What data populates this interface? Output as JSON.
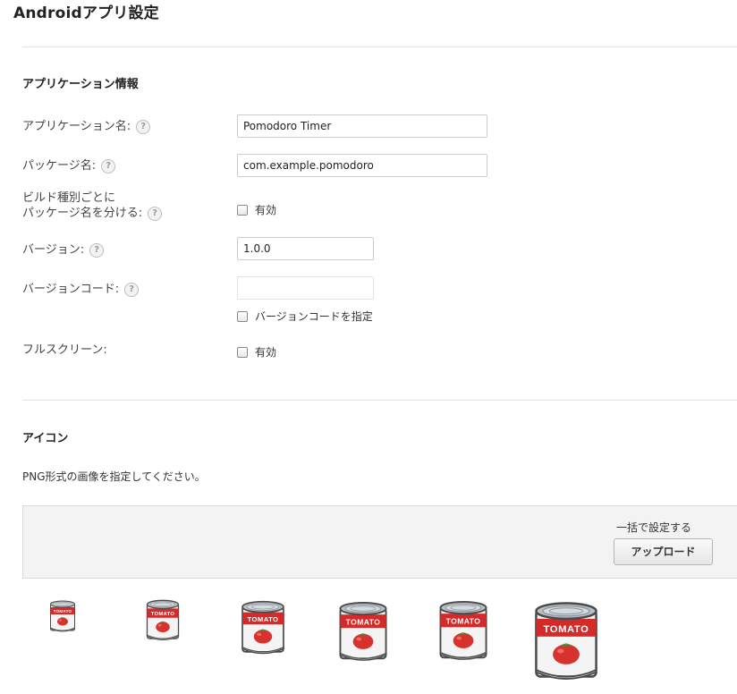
{
  "page": {
    "title": "Androidアプリ設定"
  },
  "app_info": {
    "section_title": "アプリケーション情報",
    "app_name": {
      "label": "アプリケーション名:",
      "value": "Pomodoro Timer"
    },
    "package_name": {
      "label": "パッケージ名:",
      "value": "com.example.pomodoro"
    },
    "split_package": {
      "label_line1": "ビルド種別ごとに",
      "label_line2": "パッケージ名を分ける:",
      "checkbox_label": "有効"
    },
    "version": {
      "label": "バージョン:",
      "value": "1.0.0"
    },
    "version_code": {
      "label": "バージョンコード:",
      "value": "",
      "checkbox_label": "バージョンコードを指定"
    },
    "fullscreen": {
      "label": "フルスクリーン:",
      "checkbox_label": "有効"
    },
    "help_glyph": "?"
  },
  "icon_section": {
    "section_title": "アイコン",
    "description": "PNG形式の画像を指定してください。",
    "bulk_label": "一括で設定する",
    "upload_button": "アップロード",
    "can_label": "TOMATO",
    "icon_count": 6
  },
  "colors": {
    "can_red": "#d42a2a",
    "can_silver": "#b9c0c6",
    "tomato_red": "#d8322e",
    "leaf_green": "#4c8a2e"
  }
}
